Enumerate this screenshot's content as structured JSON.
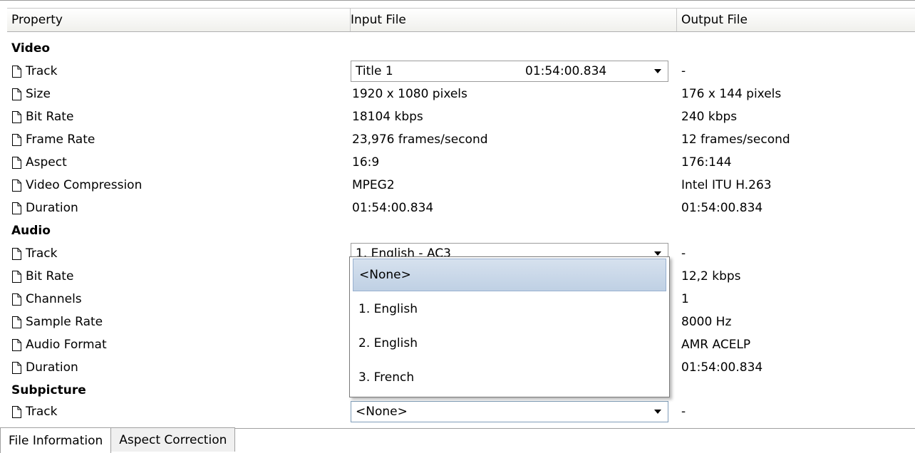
{
  "columns": {
    "property": "Property",
    "input": "Input File",
    "output": "Output File"
  },
  "video": {
    "header": "Video",
    "track": {
      "label": "Track",
      "input_title": "Title 1",
      "input_time": "01:54:00.834",
      "output": "-"
    },
    "rows": [
      {
        "label": "Size",
        "input": "1920 x 1080 pixels",
        "output": "176 x 144 pixels"
      },
      {
        "label": "Bit Rate",
        "input": "18104 kbps",
        "output": "240 kbps"
      },
      {
        "label": "Frame Rate",
        "input": "23,976 frames/second",
        "output": "12 frames/second"
      },
      {
        "label": "Aspect",
        "input": "16:9",
        "output": "176:144"
      },
      {
        "label": "Video Compression",
        "input": "MPEG2",
        "output": "Intel ITU H.263"
      },
      {
        "label": "Duration",
        "input": "01:54:00.834",
        "output": "01:54:00.834"
      }
    ]
  },
  "audio": {
    "header": "Audio",
    "track": {
      "label": "Track",
      "input": "1. English - AC3",
      "output": "-"
    },
    "rows": [
      {
        "label": "Bit Rate",
        "output": "12,2 kbps"
      },
      {
        "label": "Channels",
        "output": "1"
      },
      {
        "label": "Sample Rate",
        "output": "8000 Hz"
      },
      {
        "label": "Audio Format",
        "output": "AMR ACELP"
      },
      {
        "label": "Duration",
        "output": "01:54:00.834"
      }
    ]
  },
  "subpicture": {
    "header": "Subpicture",
    "track": {
      "label": "Track",
      "input": "<None>",
      "output": "-"
    }
  },
  "dropdown": {
    "options": [
      "<None>",
      "1. English",
      "2. English",
      "3. French"
    ],
    "highlighted": "<None>"
  },
  "tabs": [
    "File Information",
    "Aspect Correction"
  ],
  "icons": {
    "property": "document-icon",
    "combo": "dropdown-arrow-icon"
  },
  "colors": {
    "highlight": "#c6d6ea",
    "border": "#9c9c9c"
  }
}
